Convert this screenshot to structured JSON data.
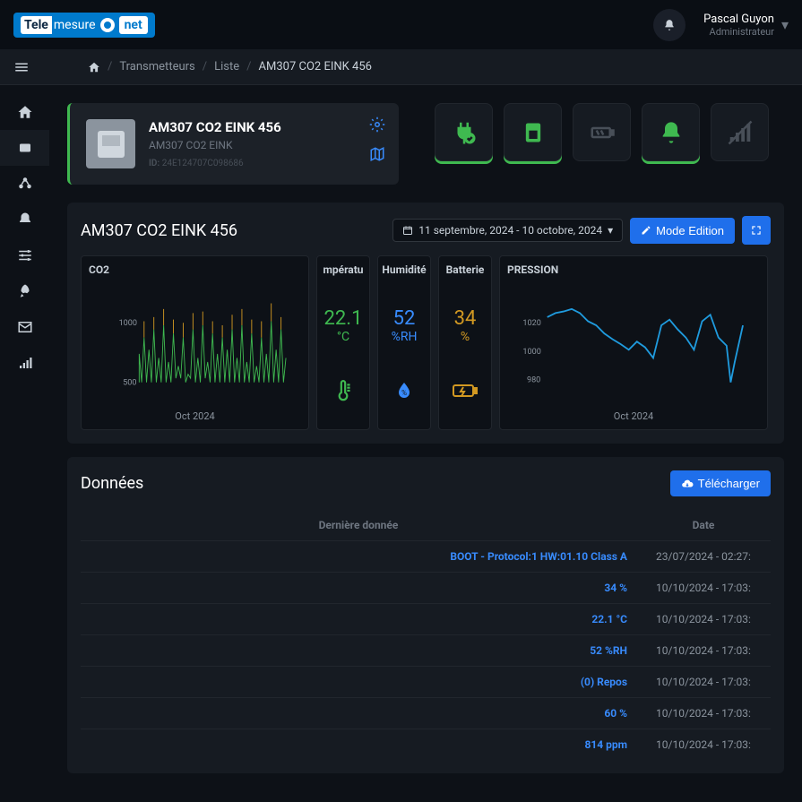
{
  "logo": {
    "tele": "Tele",
    "mesure": "mesure",
    "net": "net"
  },
  "user": {
    "name": "Pascal Guyon",
    "role": "Administrateur"
  },
  "breadcrumb": {
    "transmitters": "Transmetteurs",
    "list": "Liste",
    "current": "AM307 CO2 EINK 456"
  },
  "device": {
    "title": "AM307 CO2 EINK 456",
    "subtitle": "AM307 CO2 EINK",
    "id_label": "ID:",
    "id_value": "24E124707C098686"
  },
  "panel": {
    "title": "AM307 CO2 EINK 456",
    "date_range": "11 septembre, 2024 - 10 octobre, 2024",
    "edit_btn": "Mode Edition"
  },
  "widgets": {
    "co2": {
      "title": "CO2",
      "xlabel": "Oct 2024"
    },
    "temp": {
      "title": "mpératu",
      "value": "22.1",
      "unit": "°C"
    },
    "humidity": {
      "title": "Humidité",
      "value": "52",
      "unit": "%RH"
    },
    "battery": {
      "title": "Batterie",
      "value": "34",
      "unit": "%"
    },
    "pressure": {
      "title": "PRESSION",
      "xlabel": "Oct 2024"
    }
  },
  "data_section": {
    "title": "Données",
    "download": "Télécharger",
    "col_data": "Dernière donnée",
    "col_date": "Date",
    "rows": [
      {
        "data": "BOOT - Protocol:1 HW:01.10 Class A",
        "date": "23/07/2024 - 02:27:"
      },
      {
        "data": "34 %",
        "date": "10/10/2024 - 17:03:"
      },
      {
        "data": "22.1 °C",
        "date": "10/10/2024 - 17:03:"
      },
      {
        "data": "52 %RH",
        "date": "10/10/2024 - 17:03:"
      },
      {
        "data": "(0) Repos",
        "date": "10/10/2024 - 17:03:"
      },
      {
        "data": "60 %",
        "date": "10/10/2024 - 17:03:"
      },
      {
        "data": "814 ppm",
        "date": "10/10/2024 - 17:03:"
      }
    ]
  },
  "chart_data": [
    {
      "type": "line",
      "title": "CO2",
      "ylabel": "",
      "xlabel": "Oct 2024",
      "ylim": [
        400,
        1400
      ],
      "ticks": [
        500,
        1000
      ],
      "note": "spiky daily pattern between ~500 and ~1200"
    },
    {
      "type": "line",
      "title": "PRESSION",
      "ylabel": "",
      "xlabel": "Oct 2024",
      "ylim": [
        975,
        1030
      ],
      "ticks": [
        980,
        1000,
        1020
      ],
      "series": [
        {
          "name": "pressure",
          "values": [
            1025,
            1020,
            1015,
            1010,
            998,
            1003,
            995,
            1020,
            1015,
            1000,
            1022,
            1008,
            980,
            1010
          ]
        }
      ]
    }
  ]
}
